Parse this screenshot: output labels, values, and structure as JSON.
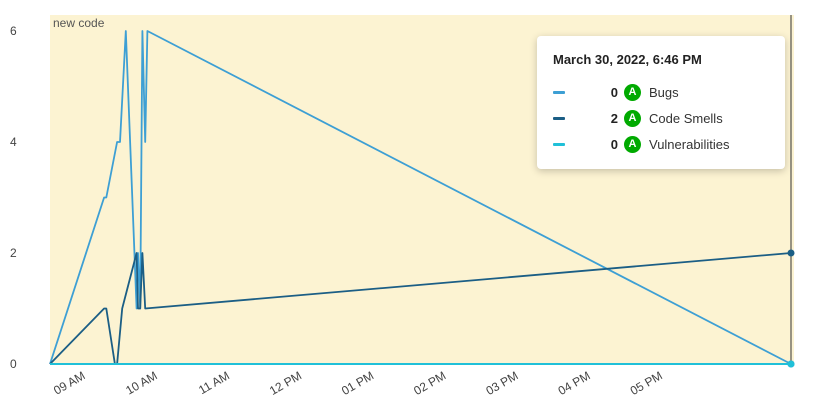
{
  "chart_data": {
    "type": "line",
    "area_label": "new code",
    "x_ticks": [
      "09 AM",
      "10 AM",
      "11 AM",
      "12 PM",
      "01 PM",
      "02 PM",
      "03 PM",
      "04 PM",
      "05 PM"
    ],
    "y_ticks": [
      "0",
      "2",
      "4",
      "6"
    ],
    "ylim": [
      0,
      6
    ],
    "x_range_hours": [
      8.5,
      18.77
    ],
    "series": [
      {
        "name": "Bugs",
        "color": "#3d9fd4",
        "points": [
          [
            8.5,
            0
          ],
          [
            9.25,
            3
          ],
          [
            9.28,
            3
          ],
          [
            9.43,
            4
          ],
          [
            9.47,
            4
          ],
          [
            9.55,
            6
          ],
          [
            9.7,
            1
          ],
          [
            9.72,
            2
          ],
          [
            9.75,
            1
          ],
          [
            9.78,
            6
          ],
          [
            9.82,
            4
          ],
          [
            9.85,
            6
          ],
          [
            18.77,
            0
          ]
        ]
      },
      {
        "name": "Code Smells",
        "color": "#1b5e85",
        "points": [
          [
            8.5,
            0
          ],
          [
            9.25,
            1
          ],
          [
            9.28,
            1
          ],
          [
            9.4,
            0
          ],
          [
            9.43,
            0
          ],
          [
            9.5,
            1
          ],
          [
            9.7,
            2
          ],
          [
            9.72,
            1
          ],
          [
            9.75,
            1
          ],
          [
            9.78,
            2
          ],
          [
            9.82,
            1
          ],
          [
            18.77,
            2
          ]
        ]
      },
      {
        "name": "Vulnerabilities",
        "color": "#20c0d8",
        "points": [
          [
            8.5,
            0
          ],
          [
            18.77,
            0
          ]
        ]
      }
    ],
    "grid": false,
    "new_code_background": "#fcf3d2"
  },
  "tooltip": {
    "date": "March 30, 2022, 6:46 PM",
    "rows": [
      {
        "value": "0",
        "rating": "A",
        "name": "Bugs",
        "color": "#3d9fd4"
      },
      {
        "value": "2",
        "rating": "A",
        "name": "Code Smells",
        "color": "#1b5e85"
      },
      {
        "value": "0",
        "rating": "A",
        "name": "Vulnerabilities",
        "color": "#20c0d8"
      }
    ]
  }
}
